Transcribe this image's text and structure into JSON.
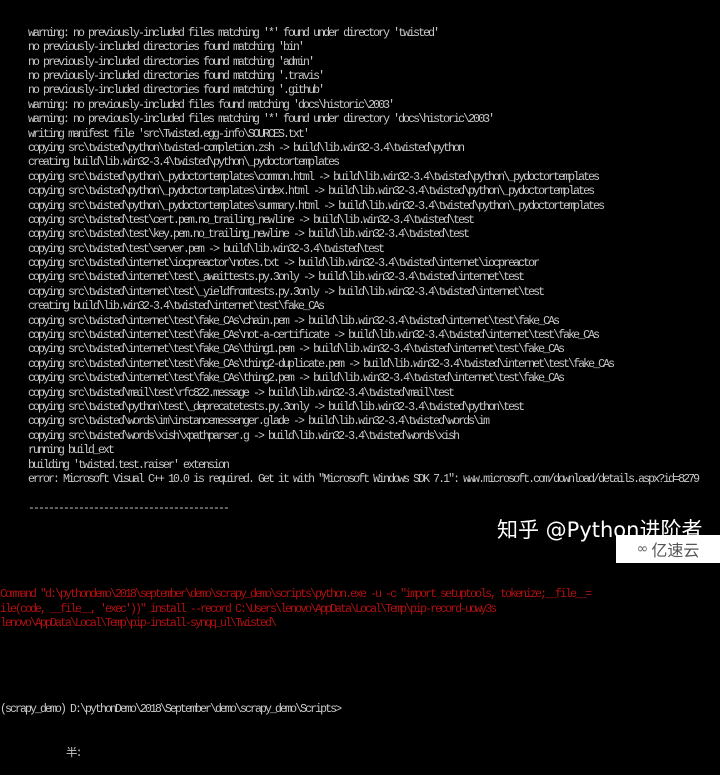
{
  "terminal": {
    "output_lines": [
      "warning: no previously-included files matching '*' found under directory 'twisted'",
      "no previously-included directories found matching 'bin'",
      "no previously-included directories found matching 'admin'",
      "no previously-included directories found matching '.travis'",
      "no previously-included directories found matching '.github'",
      "warning: no previously-included files found matching 'docs\\historic\\2003'",
      "warning: no previously-included files matching '*' found under directory 'docs\\historic\\2003'",
      "writing manifest file 'src\\Twisted.egg-info\\SOURCES.txt'",
      "copying src\\twisted\\python\\twisted-completion.zsh -> build\\lib.win32-3.4\\twisted\\python",
      "creating build\\lib.win32-3.4\\twisted\\python\\_pydoctortemplates",
      "copying src\\twisted\\python\\_pydoctortemplates\\common.html -> build\\lib.win32-3.4\\twisted\\python\\_pydoctortemplates",
      "copying src\\twisted\\python\\_pydoctortemplates\\index.html -> build\\lib.win32-3.4\\twisted\\python\\_pydoctortemplates",
      "copying src\\twisted\\python\\_pydoctortemplates\\summary.html -> build\\lib.win32-3.4\\twisted\\python\\_pydoctortemplates",
      "copying src\\twisted\\test\\cert.pem.no_trailing_newline -> build\\lib.win32-3.4\\twisted\\test",
      "copying src\\twisted\\test\\key.pem.no_trailing_newline -> build\\lib.win32-3.4\\twisted\\test",
      "copying src\\twisted\\test\\server.pem -> build\\lib.win32-3.4\\twisted\\test",
      "copying src\\twisted\\internet\\iocpreactor\\notes.txt -> build\\lib.win32-3.4\\twisted\\internet\\iocpreactor",
      "copying src\\twisted\\internet\\test\\_awaittests.py.3only -> build\\lib.win32-3.4\\twisted\\internet\\test",
      "copying src\\twisted\\internet\\test\\_yieldfromtests.py.3only -> build\\lib.win32-3.4\\twisted\\internet\\test",
      "creating build\\lib.win32-3.4\\twisted\\internet\\test\\fake_CAs",
      "copying src\\twisted\\internet\\test\\fake_CAs\\chain.pem -> build\\lib.win32-3.4\\twisted\\internet\\test\\fake_CAs",
      "copying src\\twisted\\internet\\test\\fake_CAs\\not-a-certificate -> build\\lib.win32-3.4\\twisted\\internet\\test\\fake_CAs",
      "copying src\\twisted\\internet\\test\\fake_CAs\\thing1.pem -> build\\lib.win32-3.4\\twisted\\internet\\test\\fake_CAs",
      "copying src\\twisted\\internet\\test\\fake_CAs\\thing2-duplicate.pem -> build\\lib.win32-3.4\\twisted\\internet\\test\\fake_CAs",
      "copying src\\twisted\\internet\\test\\fake_CAs\\thing2.pem -> build\\lib.win32-3.4\\twisted\\internet\\test\\fake_CAs",
      "copying src\\twisted\\mail\\test\\rfc822.message -> build\\lib.win32-3.4\\twisted\\mail\\test",
      "copying src\\twisted\\python\\test\\_deprecatetests.py.3only -> build\\lib.win32-3.4\\twisted\\python\\test",
      "copying src\\twisted\\words\\im\\instancemessenger.glade -> build\\lib.win32-3.4\\twisted\\words\\im",
      "copying src\\twisted\\words\\xish\\xpathparser.g -> build\\lib.win32-3.4\\twisted\\words\\xish",
      "running build_ext",
      "building 'twisted.test.raiser' extension",
      "error: Microsoft Visual C++ 10.0 is required. Get it with \"Microsoft Windows SDK 7.1\": www.microsoft.com/download/details.aspx?id=8279",
      "",
      "----------------------------------------"
    ],
    "error_lines": [
      "Command \"d:\\pythondemo\\2018\\september\\demo\\scrapy_demo\\scripts\\python.exe -u -c \"import setuptools, tokenize;__file__=",
      "ile(code, __file__, 'exec'))\" install --record C:\\Users\\lenovo\\AppData\\Local\\Temp\\pip-record-uowy3s",
      "lenovo\\AppData\\Local\\Temp\\pip-install-synqq_ul\\Twisted\\"
    ],
    "prompt": "(scrapy_demo) D:\\pythonDemo\\2018\\September\\demo\\scrapy_demo\\Scripts>",
    "ime_text": "半:",
    "colors": {
      "background": "#000000",
      "text": "#c8c8c8",
      "error": "#b01010"
    }
  },
  "watermark": "知乎 @Python进阶者",
  "logo": {
    "text": "亿速云",
    "icon": "yisu-cloud-logo-icon"
  }
}
